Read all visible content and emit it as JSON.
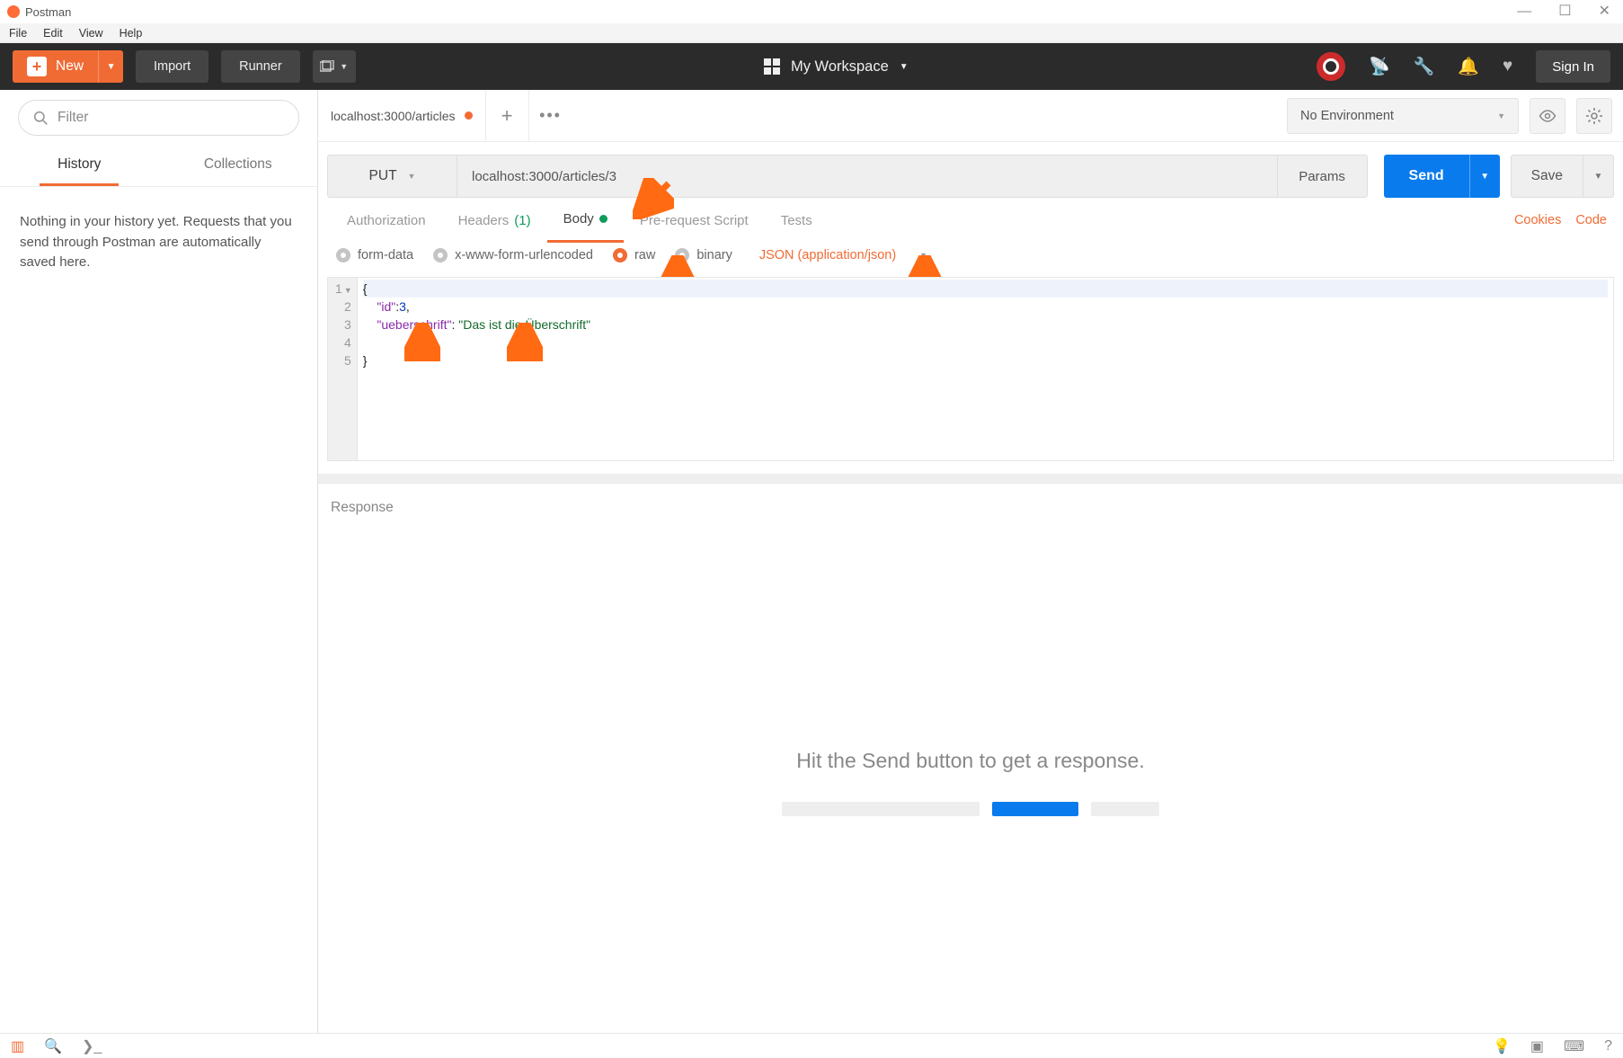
{
  "window": {
    "title": "Postman"
  },
  "menu": [
    "File",
    "Edit",
    "View",
    "Help"
  ],
  "toolbar": {
    "new": "New",
    "import": "Import",
    "runner": "Runner",
    "workspace": "My Workspace",
    "signin": "Sign In"
  },
  "sidebar": {
    "filter_placeholder": "Filter",
    "tabs": {
      "history": "History",
      "collections": "Collections",
      "active": "history"
    },
    "history_empty": "Nothing in your history yet. Requests that you send through Postman are automatically saved here."
  },
  "tabbar": {
    "tab_title": "localhost:3000/articles",
    "environment": "No Environment"
  },
  "request": {
    "method": "PUT",
    "url": "localhost:3000/articles/3",
    "params": "Params",
    "send": "Send",
    "save": "Save"
  },
  "subtabs": {
    "authorization": "Authorization",
    "headers": "Headers",
    "headers_count": "(1)",
    "body": "Body",
    "prerequest": "Pre-request Script",
    "tests": "Tests",
    "cookies": "Cookies",
    "code": "Code"
  },
  "body_type": {
    "formdata": "form-data",
    "urlencoded": "x-www-form-urlencoded",
    "raw": "raw",
    "binary": "binary",
    "content_type": "JSON (application/json)"
  },
  "editor": {
    "lines": [
      "1",
      "2",
      "3",
      "4",
      "5"
    ],
    "code_l1": "{",
    "code_l2_pre": "    ",
    "code_l2_key": "\"id\"",
    "code_l2_mid": ":",
    "code_l2_val": "3",
    "code_l2_end": ",",
    "code_l3_pre": "    ",
    "code_l3_key": "\"ueberschrift\"",
    "code_l3_mid": ": ",
    "code_l3_val": "\"Das ist die Überschrift\"",
    "code_l5": "}"
  },
  "response": {
    "label": "Response",
    "hint": "Hit the Send button to get a response."
  }
}
